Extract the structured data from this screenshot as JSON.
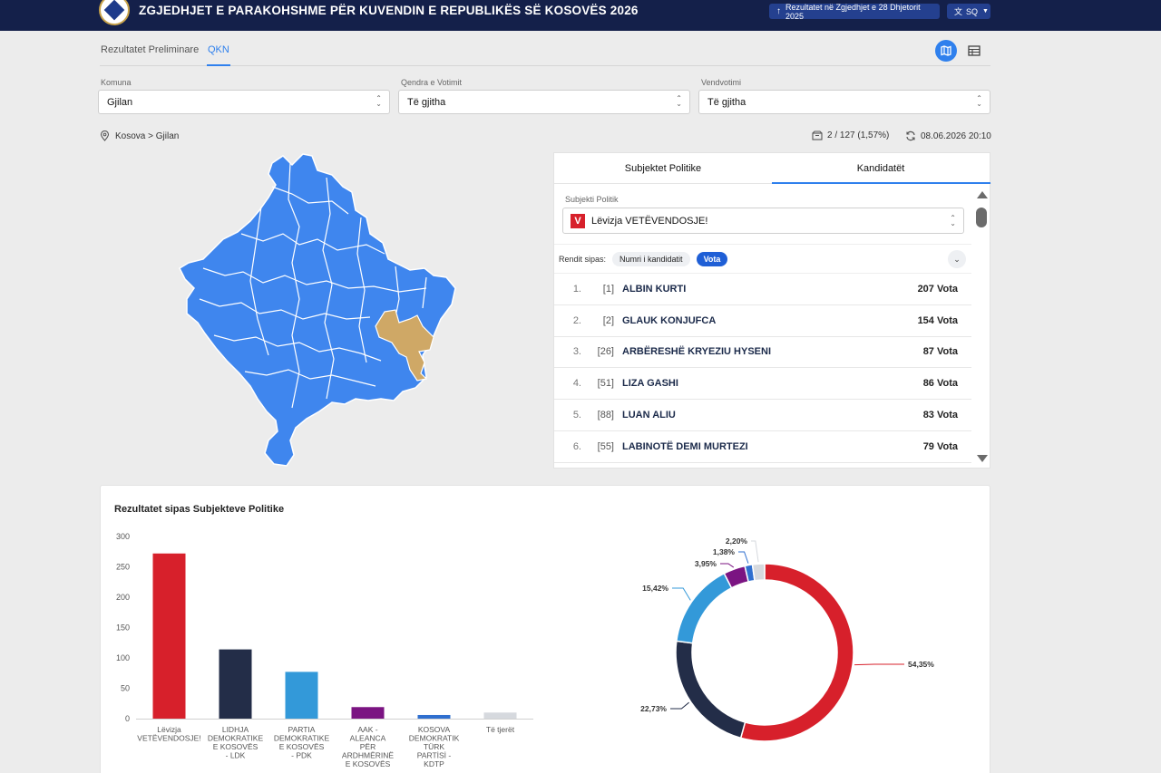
{
  "header": {
    "title": "ZGJEDHJET E PARAKOHSHME PËR KUVENDIN E REPUBLIKËS SË KOSOVËS 2026",
    "previous_results_label": "Rezultatet në Zgjedhjet e 28 Dhjetorit 2025",
    "language_label": "SQ"
  },
  "tabs": [
    {
      "label": "Rezultatet Preliminare"
    },
    {
      "label": "QKN"
    }
  ],
  "filters": {
    "komuna": {
      "label": "Komuna",
      "value": "Gjilan"
    },
    "qendra": {
      "label": "Qendra e Votimit",
      "value": "Të gjitha"
    },
    "vendvotimi": {
      "label": "Vendvotimi",
      "value": "Të gjitha"
    }
  },
  "breadcrumb": "Kosova > Gjilan",
  "stats": {
    "stations": "2 / 127 (1,57%)",
    "updated": "08.06.2026 20:10"
  },
  "panel": {
    "tab_parties": "Subjektet Politike",
    "tab_candidates": "Kandidatët",
    "subject_label": "Subjekti Politik",
    "subject_value": "Lëvizja VETËVENDOSJE!",
    "subject_logo": "V",
    "sort_label": "Rendit sipas:",
    "sort_option_1": "Numri i kandidatit",
    "sort_option_2": "Vota",
    "candidates": [
      {
        "rank": "1.",
        "num": "[1]",
        "name": "ALBIN KURTI",
        "votes": "207 Vota"
      },
      {
        "rank": "2.",
        "num": "[2]",
        "name": "GLAUK KONJUFCA",
        "votes": "154 Vota"
      },
      {
        "rank": "3.",
        "num": "[26]",
        "name": "ARBËRESHË KRYEZIU HYSENI",
        "votes": "87 Vota"
      },
      {
        "rank": "4.",
        "num": "[51]",
        "name": "LIZA GASHI",
        "votes": "86 Vota"
      },
      {
        "rank": "5.",
        "num": "[88]",
        "name": "LUAN ALIU",
        "votes": "83 Vota"
      },
      {
        "rank": "6.",
        "num": "[55]",
        "name": "LABINOTË DEMI MURTEZI",
        "votes": "79 Vota"
      }
    ]
  },
  "results": {
    "title": "Rezultatet sipas Subjekteve Politike"
  },
  "colors": {
    "navy": "#14204a",
    "accent": "#2f80ed",
    "map_blue": "#3f86ee",
    "map_highlight": "#cfa866"
  },
  "chart_data": [
    {
      "type": "bar",
      "categories": [
        [
          "Lëvizja",
          "VETËVENDOSJE!"
        ],
        [
          "LIDHJA",
          "DEMOKRATIKE",
          "E KOSOVËS",
          "- LDK"
        ],
        [
          "PARTIA",
          "DEMOKRATIKE",
          "E KOSOVËS",
          "- PDK"
        ],
        [
          "AAK -",
          "ALEANCA",
          "PËR",
          "ARDHMËRINË",
          "E KOSOVËS"
        ],
        [
          "KOSOVA",
          "DEMOKRATIK",
          "TÜRK",
          "PARTİSİ -",
          "KDTP"
        ],
        [
          "Të tjerët"
        ]
      ],
      "values": [
        272,
        114,
        77,
        19,
        6,
        10
      ],
      "colors": [
        "#d7202b",
        "#232d48",
        "#3399d9",
        "#7b1482",
        "#2f6fcf",
        "#d6d9de"
      ],
      "yticks": [
        0,
        50,
        100,
        150,
        200,
        250,
        300
      ],
      "ylim": [
        0,
        300
      ]
    },
    {
      "type": "pie",
      "values": [
        54.35,
        22.73,
        15.42,
        3.95,
        1.38,
        2.2
      ],
      "labels": [
        "54,35%",
        "22,73%",
        "15,42%",
        "3,95%",
        "1,38%",
        "2,20%"
      ],
      "colors": [
        "#d7202b",
        "#232d48",
        "#3399d9",
        "#7b1482",
        "#2f6fcf",
        "#d6d9de"
      ]
    }
  ]
}
